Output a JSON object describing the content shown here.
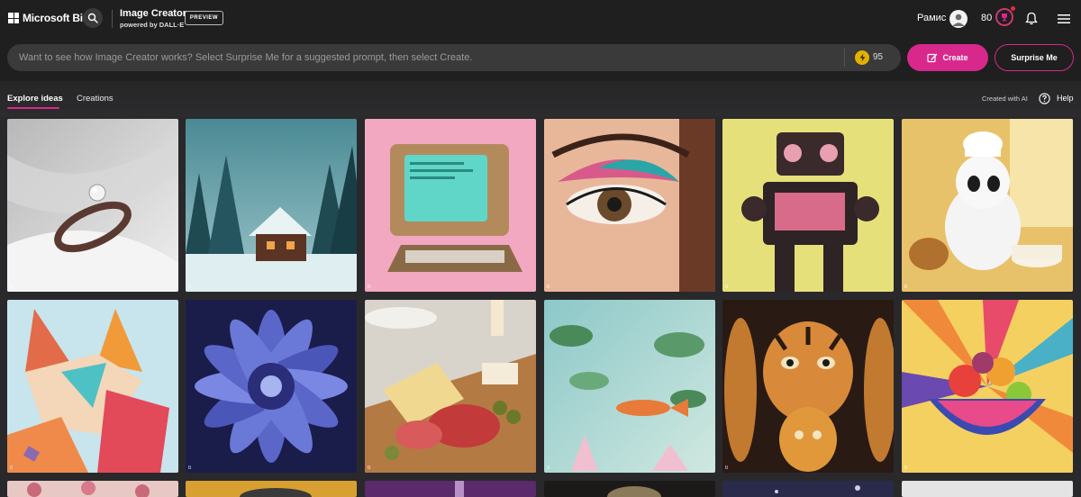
{
  "header": {
    "brand": "Microsoft Bing",
    "app_title": "Image Creator",
    "app_subtitle": "powered by DALL·E",
    "badge": "PREVIEW",
    "user_name": "Рамис",
    "reward_points": "80"
  },
  "prompt": {
    "placeholder": "Want to see how Image Creator works? Select Surprise Me for a suggested prompt, then select Create.",
    "boosts": "95",
    "create_label": "Create",
    "surprise_label": "Surprise Me"
  },
  "tabs": [
    {
      "label": "Explore ideas",
      "active": true
    },
    {
      "label": "Creations",
      "active": false
    }
  ],
  "toolbar": {
    "created_with_ai": "Created with AI",
    "help_label": "Help"
  },
  "tile_mark": "b",
  "colors": {
    "accent": "#d8288c",
    "background": "#1f1f1f",
    "prompt_box": "#3a3a3a",
    "boost": "#e2b100"
  },
  "icons": [
    "microsoft-logo",
    "search-icon",
    "user-avatar-icon",
    "rewards-trophy-icon",
    "bell-icon",
    "hamburger-menu-icon",
    "boost-bolt-icon",
    "create-icon",
    "help-icon"
  ]
}
